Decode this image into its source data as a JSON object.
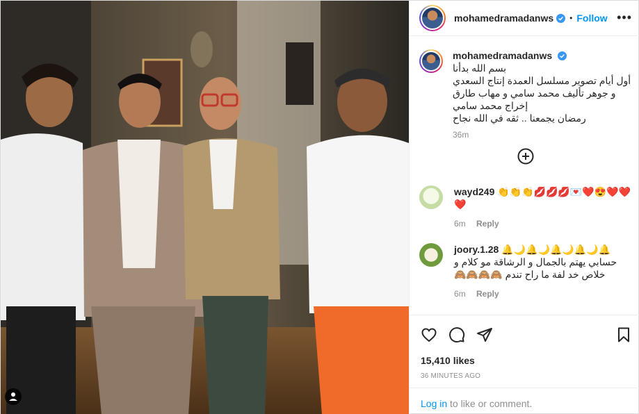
{
  "post": {
    "username": "mohamedramadanws",
    "dot": "•",
    "follow_label": "Follow",
    "caption": "بسم الله بدأنا\nأول أيام تصوير مسلسل العمدة إنتاج السعدي و جوهر تأليف محمد سامي و مهاب طارق إخراج محمد سامي\nرمضان يجمعنا .. ثقه في الله نجاح",
    "caption_time": "36m",
    "likes": "15,410 likes",
    "time_ago": "36 MINUTES AGO",
    "login_link": "Log in",
    "login_text": " to like or comment."
  },
  "comments": [
    {
      "username": "wayd249",
      "text": "👏👏👏💋💋💋💌❤️😍❤️❤️❤️",
      "time": "6m",
      "reply_label": "Reply"
    },
    {
      "username": "joory.1.28",
      "text": "🔔🌙🔔🌙🔔🌙🔔🌙🔔\nحسابي يهتم بالجمال و الرشاقة مو كلام و خلاص خد لفة ما راح تندم 🙈🙈🙈🙈",
      "time": "6m",
      "reply_label": "Reply"
    }
  ],
  "icons": {
    "verified": "verified-badge-icon",
    "more": "more-options-icon",
    "add": "add-circle-icon",
    "like": "heart-icon",
    "comment": "comment-icon",
    "share": "share-icon",
    "save": "bookmark-icon",
    "tag": "user-tag-icon"
  },
  "colors": {
    "accent": "#0095f6",
    "muted": "#8e8e8e",
    "text": "#262626"
  }
}
